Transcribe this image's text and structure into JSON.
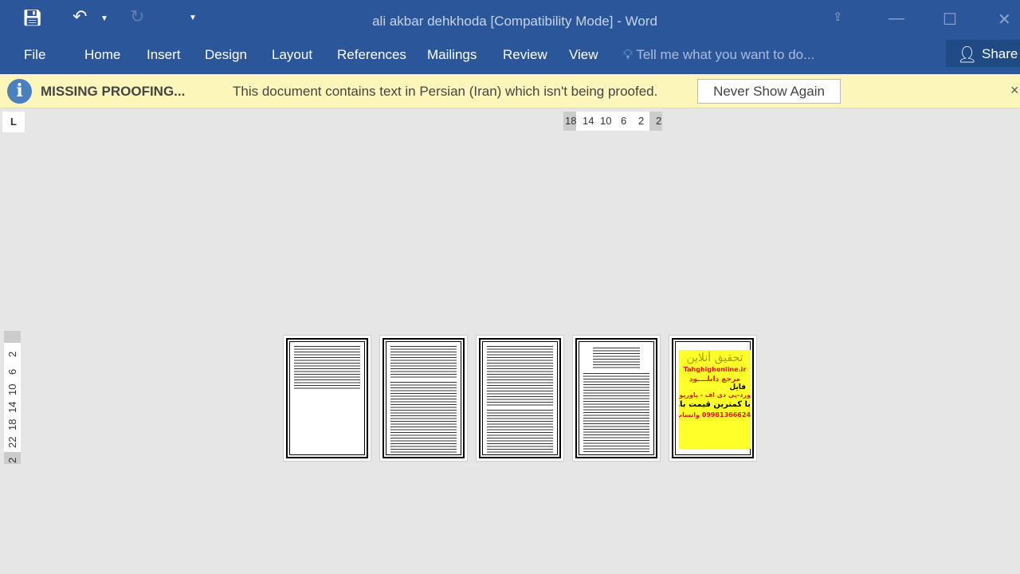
{
  "window": {
    "title": "ali akbar dehkhoda [Compatibility Mode] - Word"
  },
  "quick_access": {
    "save": "save-icon",
    "undo": "undo-icon",
    "redo": "redo-icon",
    "customize": "customize-icon"
  },
  "ribbon": {
    "tabs": [
      "File",
      "Home",
      "Insert",
      "Design",
      "Layout",
      "References",
      "Mailings",
      "Review",
      "View"
    ],
    "tell_me": "Tell me what you want to do...",
    "share": "Share"
  },
  "message_bar": {
    "title": "MISSING PROOFING...",
    "text": "This document contains text in Persian (Iran) which isn't being proofed.",
    "button": "Never Show Again",
    "close": "×"
  },
  "rulers": {
    "horizontal": [
      "18",
      "14",
      "10",
      "6",
      "2",
      "2"
    ],
    "vertical": [
      "2",
      "2",
      "6",
      "10",
      "14",
      "18",
      "22"
    ],
    "tab_selector": "L"
  },
  "pages": [
    {
      "index": 1
    },
    {
      "index": 2
    },
    {
      "index": 3
    },
    {
      "index": 4
    },
    {
      "index": 5,
      "ad": {
        "title": "تحقیق آنلاین",
        "site": "Tahghighonline.ir",
        "l1": "مرجع دانلــــود",
        "l2": "فایل",
        "l3": "ورد-پی دی اف - پاورپوینت",
        "l4": "با کمترین قیمت بازار",
        "l5": "09981366624 واتساپ"
      }
    }
  ],
  "colors": {
    "ribbon": "#2b579a",
    "message_bar": "#fdf6bb",
    "ad_bg": "#ffff2a",
    "ad_red": "#e8161c"
  }
}
